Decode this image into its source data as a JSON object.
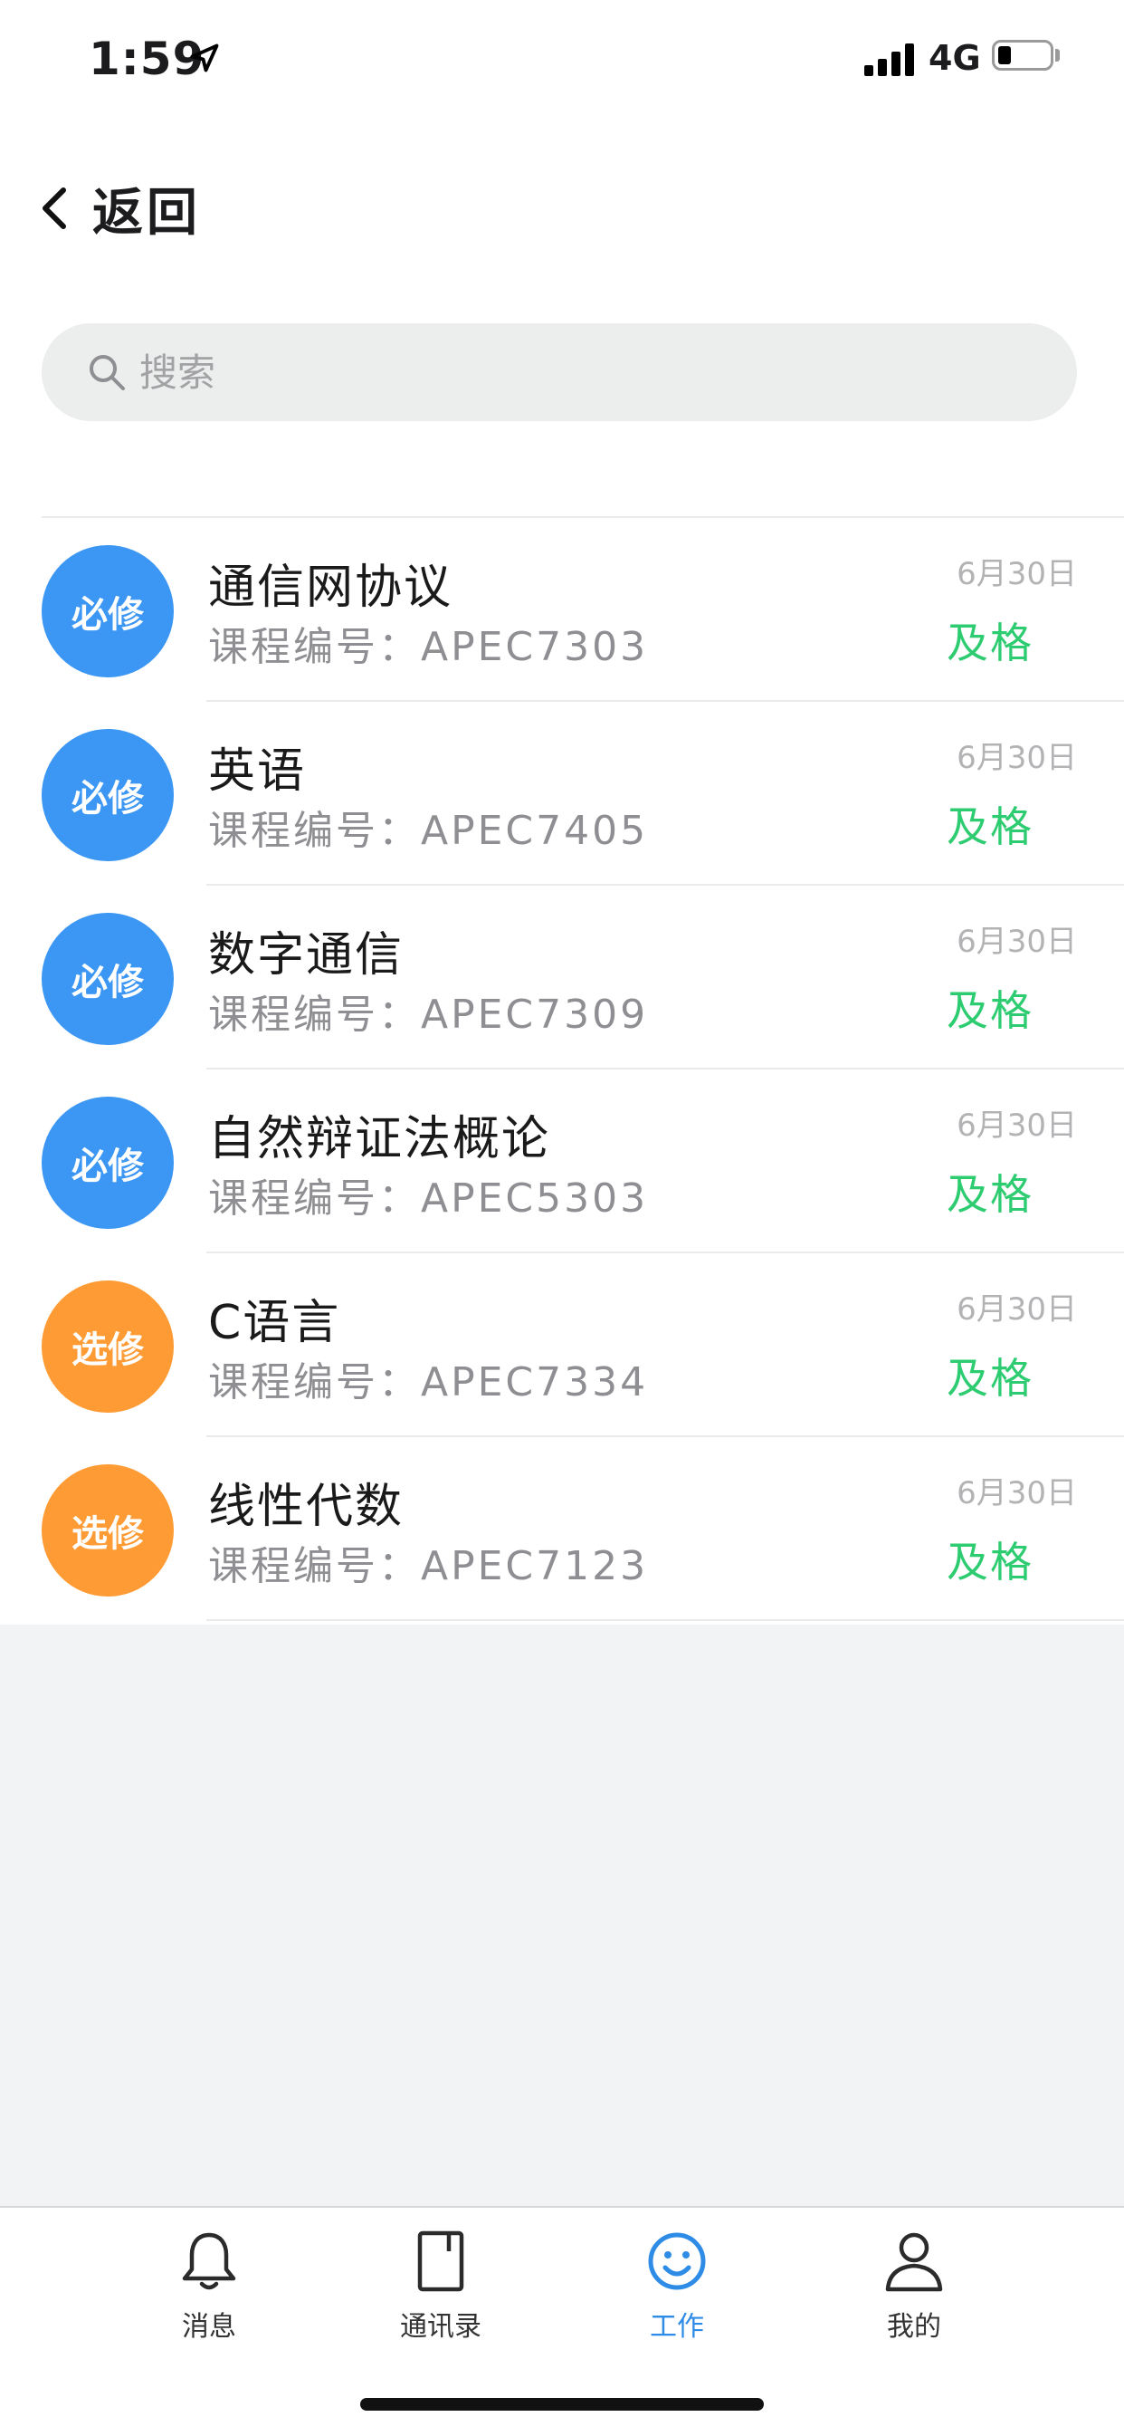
{
  "status_bar": {
    "time": "1:59",
    "network": "4G"
  },
  "nav": {
    "back_label": "返回"
  },
  "search": {
    "placeholder": "搜索"
  },
  "courses": [
    {
      "badge": "必修",
      "type": "required",
      "name": "通信网协议",
      "code": "课程编号：APEC7303",
      "date": "6月30日",
      "result": "及格"
    },
    {
      "badge": "必修",
      "type": "required",
      "name": "英语",
      "code": "课程编号：APEC7405",
      "date": "6月30日",
      "result": "及格"
    },
    {
      "badge": "必修",
      "type": "required",
      "name": "数字通信",
      "code": "课程编号：APEC7309",
      "date": "6月30日",
      "result": "及格"
    },
    {
      "badge": "必修",
      "type": "required",
      "name": "自然辩证法概论",
      "code": "课程编号：APEC5303",
      "date": "6月30日",
      "result": "及格"
    },
    {
      "badge": "选修",
      "type": "elective",
      "name": "C语言",
      "code": "课程编号：APEC7334",
      "date": "6月30日",
      "result": "及格"
    },
    {
      "badge": "选修",
      "type": "elective",
      "name": "线性代数",
      "code": "课程编号：APEC7123",
      "date": "6月30日",
      "result": "及格"
    }
  ],
  "tabs": [
    {
      "label": "消息",
      "icon": "bell-icon"
    },
    {
      "label": "通讯录",
      "icon": "contacts-book-icon"
    },
    {
      "label": "工作",
      "icon": "smiley-icon",
      "active": true
    },
    {
      "label": "我的",
      "icon": "user-icon"
    }
  ],
  "colors": {
    "required_badge": "#3b97f3",
    "elective_badge": "#fe9b34",
    "pass_text": "#2ecc71",
    "active_tab": "#2f8ce6"
  }
}
